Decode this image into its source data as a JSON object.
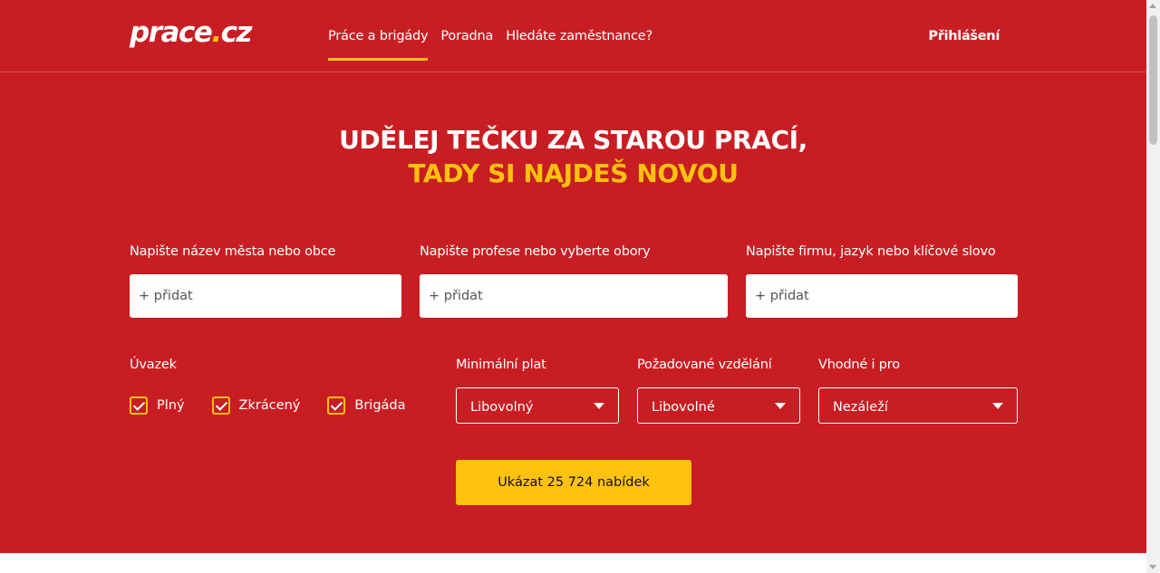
{
  "brand": {
    "logo_main": "prace",
    "logo_dot": ".",
    "logo_tld": "cz",
    "primary_color": "#c81e23",
    "accent_color": "#ffc20e"
  },
  "nav": {
    "items": [
      {
        "label": "Práce a brigády",
        "active": true
      },
      {
        "label": "Poradna",
        "active": false
      },
      {
        "label": "Hledáte zaměstnance?",
        "active": false
      }
    ],
    "login_label": "Přihlášení"
  },
  "hero": {
    "headline_line1": "UDĚLEJ TEČKU ZA STAROU PRACÍ,",
    "headline_line2": "TADY SI NAJDEŠ NOVOU"
  },
  "search": {
    "location": {
      "label": "Napište název města nebo obce",
      "placeholder": "+ přidat",
      "value": ""
    },
    "profession": {
      "label": "Napište profese nebo vyberte obory",
      "placeholder": "+ přidat",
      "value": ""
    },
    "keyword": {
      "label": "Napište firmu, jazyk nebo klíčové slovo",
      "placeholder": "+ přidat",
      "value": ""
    }
  },
  "filters": {
    "employment": {
      "label": "Úvazek",
      "options": [
        {
          "label": "Plný",
          "checked": true
        },
        {
          "label": "Zkrácený",
          "checked": true
        },
        {
          "label": "Brigáda",
          "checked": true
        }
      ]
    },
    "min_salary": {
      "label": "Minimální plat",
      "value": "Libovolný"
    },
    "education": {
      "label": "Požadované vzdělání",
      "value": "Libovolné"
    },
    "suitable_for": {
      "label": "Vhodné i pro",
      "value": "Nezáleží"
    }
  },
  "submit_label": "Ukázat 25 724 nabídek",
  "icons": {
    "checkbox": "checkmark-icon",
    "dropdown": "caret-down-icon"
  }
}
